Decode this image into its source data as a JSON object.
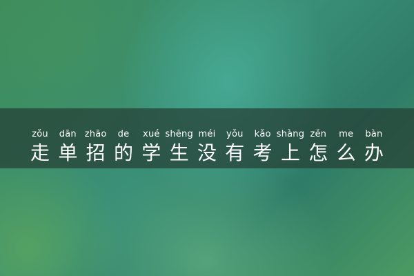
{
  "title": {
    "chars": [
      {
        "pinyin": "zǒu",
        "hanzi": "走"
      },
      {
        "pinyin": "dān",
        "hanzi": "单"
      },
      {
        "pinyin": "zhāo",
        "hanzi": "招"
      },
      {
        "pinyin": "de",
        "hanzi": "的"
      },
      {
        "pinyin": "xué",
        "hanzi": "学"
      },
      {
        "pinyin": "shēng",
        "hanzi": "生"
      },
      {
        "pinyin": "méi",
        "hanzi": "没"
      },
      {
        "pinyin": "yǒu",
        "hanzi": "有"
      },
      {
        "pinyin": "kǎo",
        "hanzi": "考"
      },
      {
        "pinyin": "shàng",
        "hanzi": "上"
      },
      {
        "pinyin": "zěn",
        "hanzi": "怎"
      },
      {
        "pinyin": "me",
        "hanzi": "么"
      },
      {
        "pinyin": "bàn",
        "hanzi": "办"
      }
    ]
  },
  "colors": {
    "text": "#ffffff",
    "band": "#263e34",
    "background": "#3a8f77"
  }
}
